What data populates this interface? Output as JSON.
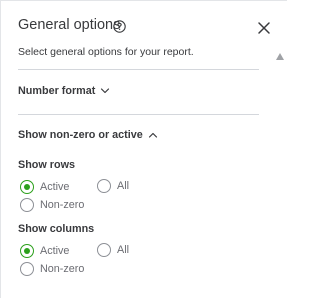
{
  "panel": {
    "title": "General options",
    "subtitle": "Select general options for your report."
  },
  "icons": {
    "help": "help-circle-icon",
    "close": "close-icon",
    "number_format_chevron": "chevron-down-icon",
    "nonzero_chevron": "chevron-up-icon",
    "scroll_up": "scroll-up-arrow-icon"
  },
  "sections": {
    "number_format": {
      "label": "Number format",
      "expanded": false
    },
    "show_nonzero": {
      "label": "Show non-zero or active",
      "expanded": true,
      "rows": {
        "label": "Show rows",
        "options": [
          {
            "label": "Active",
            "checked": true
          },
          {
            "label": "All",
            "checked": false
          },
          {
            "label": "Non-zero",
            "checked": false
          }
        ]
      },
      "columns": {
        "label": "Show columns",
        "options": [
          {
            "label": "Active",
            "checked": true
          },
          {
            "label": "All",
            "checked": false
          },
          {
            "label": "Non-zero",
            "checked": false
          }
        ]
      }
    }
  },
  "colors": {
    "accent_green": "#2ca01c",
    "text": "#393a3d",
    "muted_text": "#6b6c72",
    "divider": "#d4d7dc"
  }
}
